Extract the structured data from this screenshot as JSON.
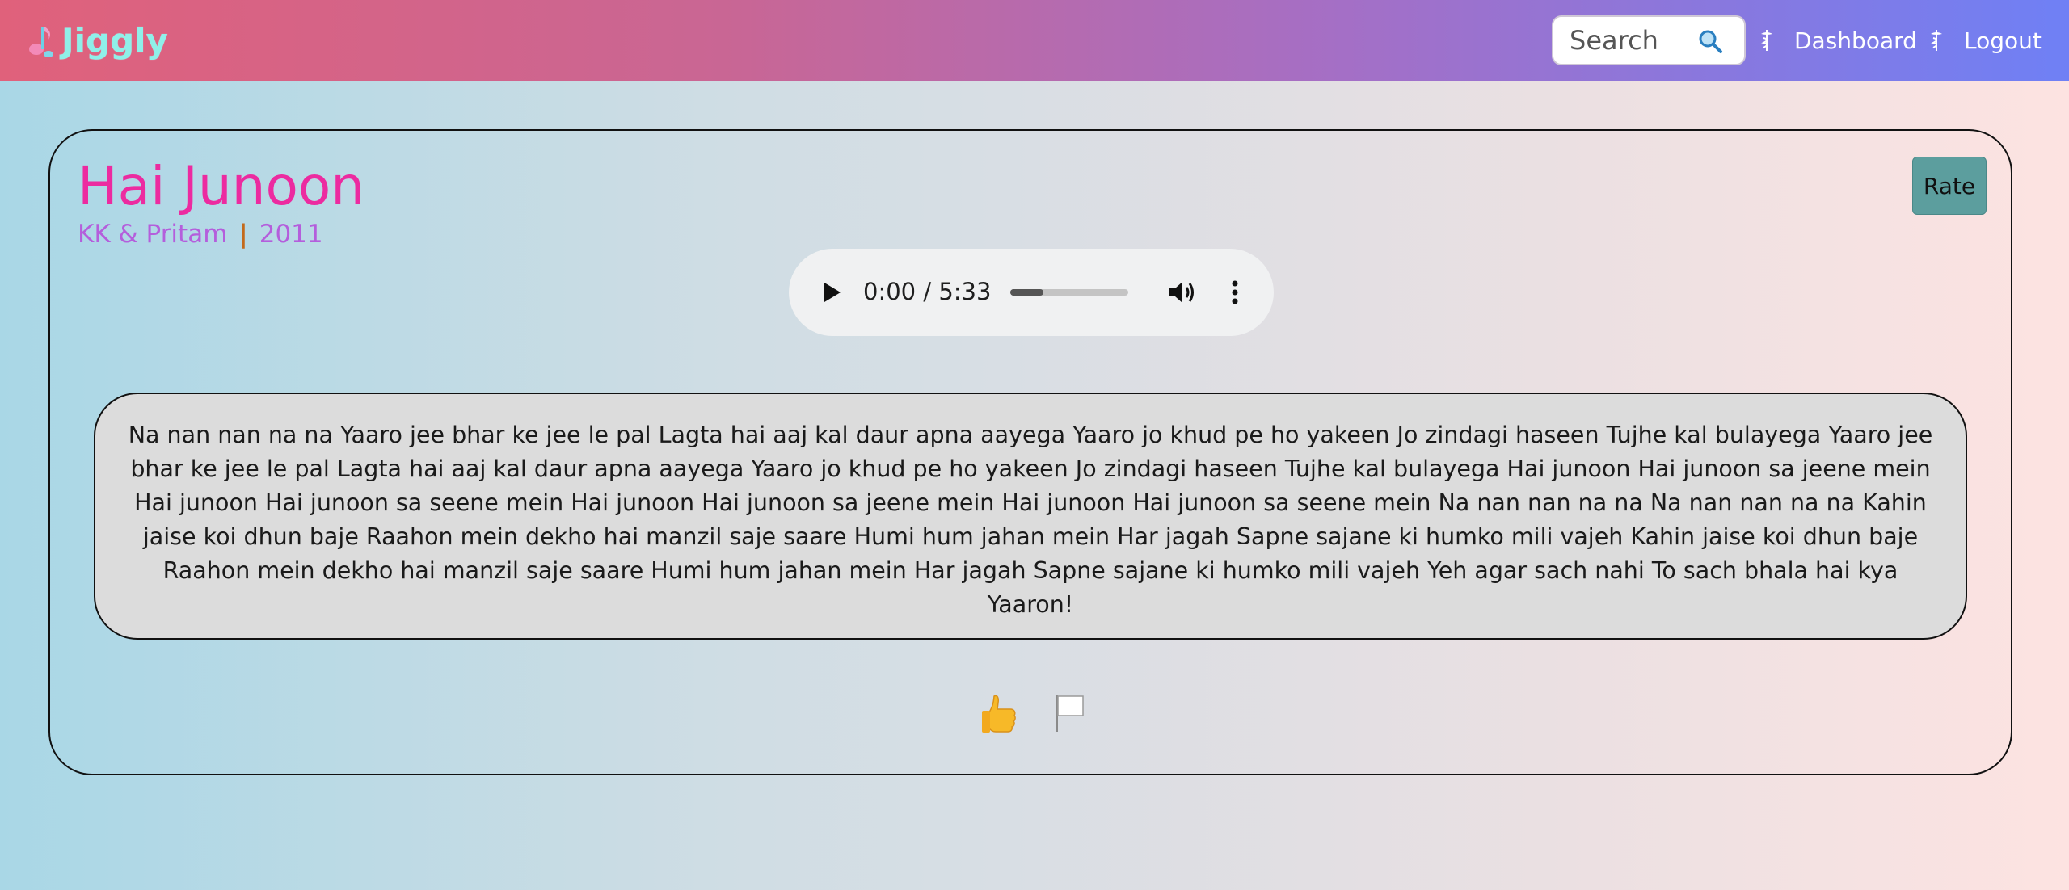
{
  "nav": {
    "brand": "Jiggly",
    "search_placeholder": "Search",
    "dashboard_label": "Dashboard",
    "logout_label": "Logout"
  },
  "song": {
    "title": "Hai Junoon",
    "artist": "KK & Pritam",
    "separator": "|",
    "year": "2011",
    "rate_label": "Rate"
  },
  "player": {
    "time": "0:00 / 5:33",
    "buffered_fraction": 0.28
  },
  "lyrics": "Na nan nan na na Yaaro jee bhar ke jee le pal Lagta hai aaj kal daur apna aayega Yaaro jo khud pe ho yakeen Jo zindagi haseen Tujhe kal bulayega Yaaro jee bhar ke jee le pal Lagta hai aaj kal daur apna aayega Yaaro jo khud pe ho yakeen Jo zindagi haseen Tujhe kal bulayega Hai junoon Hai junoon sa jeene mein Hai junoon Hai junoon sa seene mein Hai junoon Hai junoon sa jeene mein Hai junoon Hai junoon sa seene mein Na nan nan na na Na nan nan na na Kahin jaise koi dhun baje Raahon mein dekho hai manzil saje saare Humi hum jahan mein Har jagah Sapne sajane ki humko mili vajeh Kahin jaise koi dhun baje Raahon mein dekho hai manzil saje saare Humi hum jahan mein Har jagah Sapne sajane ki humko mili vajeh Yeh agar sach nahi To sach bhala hai kya Yaaron!",
  "icons": {
    "brand_logo": "music-note-icon",
    "search": "magnifier-icon",
    "dashboard": "caduceus-icon",
    "logout": "caduceus-icon",
    "like": "thumbs-up-icon",
    "report": "white-flag-icon"
  },
  "colors": {
    "title": "#ec2ba0",
    "meta": "#b45edc",
    "separator": "#c36a1b",
    "rate_button": "#5c9e9e",
    "brand": "#8ff0e9"
  }
}
